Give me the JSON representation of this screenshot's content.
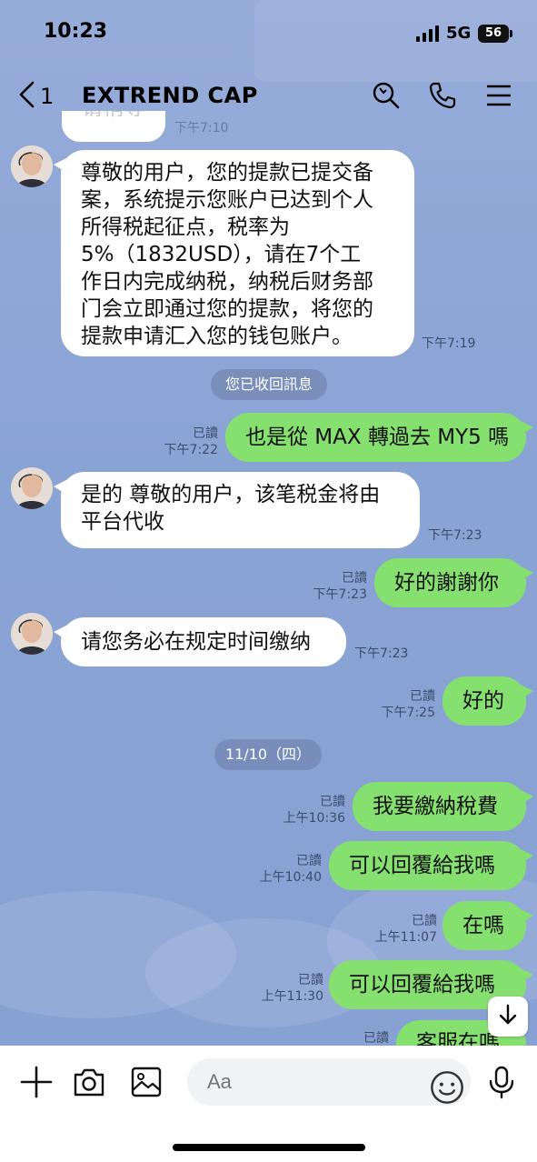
{
  "status_bar": {
    "time": "10:23",
    "network": "5G",
    "battery": "56"
  },
  "header": {
    "back_count": "1",
    "title": "EXTREND CAP"
  },
  "top_partial": {
    "text": "请稍等",
    "time": "下午7:10"
  },
  "messages": [
    {
      "type": "in",
      "text": "尊敬的用户，您的提款已提交备案，系统提示您账户已达到个人所得税起征点，税率为5%（1832USD），请在7个工作日内完成纳税，纳税后财务部门会立即通过您的提款，将您的提款申请汇入您的钱包账户。",
      "lines": [
        "尊敬的用户，您的提款已提交备",
        "案，系统提示您账户已达到个人",
        "所得税起征点，税率为",
        "5%（1832USD），请在7个工",
        "作日内完成纳税，纳税后财务部",
        "门会立即通过您的提款，将您的",
        "提款申请汇入您的钱包账户。"
      ],
      "time": "下午7:19"
    },
    {
      "type": "system",
      "text": "您已收回訊息"
    },
    {
      "type": "out",
      "text": "也是從 MAX 轉過去 MY5 嗎",
      "read": "已讀",
      "time": "下午7:22"
    },
    {
      "type": "in",
      "lines": [
        "是的 尊敬的用户，该笔税金将由",
        "平台代收"
      ],
      "time": "下午7:23"
    },
    {
      "type": "out",
      "text": "好的謝謝你",
      "read": "已讀",
      "time": "下午7:23"
    },
    {
      "type": "in",
      "text": "请您务必在规定时间缴纳",
      "time": "下午7:23"
    },
    {
      "type": "out",
      "text": "好的",
      "read": "已讀",
      "time": "下午7:25"
    },
    {
      "type": "date",
      "text": "11/10（四）"
    },
    {
      "type": "out",
      "text": "我要繳納稅費",
      "read": "已讀",
      "time": "上午10:36"
    },
    {
      "type": "out",
      "text": "可以回覆給我嗎",
      "read": "已讀",
      "time": "上午10:40"
    },
    {
      "type": "out",
      "text": "在嗎",
      "read": "已讀",
      "time": "上午11:07"
    },
    {
      "type": "out",
      "text": "可以回覆給我嗎",
      "read": "已讀",
      "time": "上午11:30"
    },
    {
      "type": "out",
      "text": "客服在嗎",
      "read": "已讀",
      "time": ""
    }
  ],
  "input_bar": {
    "placeholder": "Aa"
  },
  "icons": [
    "back-chevron-icon",
    "search-icon",
    "phone-icon",
    "menu-icon",
    "plus-icon",
    "camera-icon",
    "image-icon",
    "emoji-icon",
    "microphone-icon",
    "arrow-down-icon"
  ]
}
